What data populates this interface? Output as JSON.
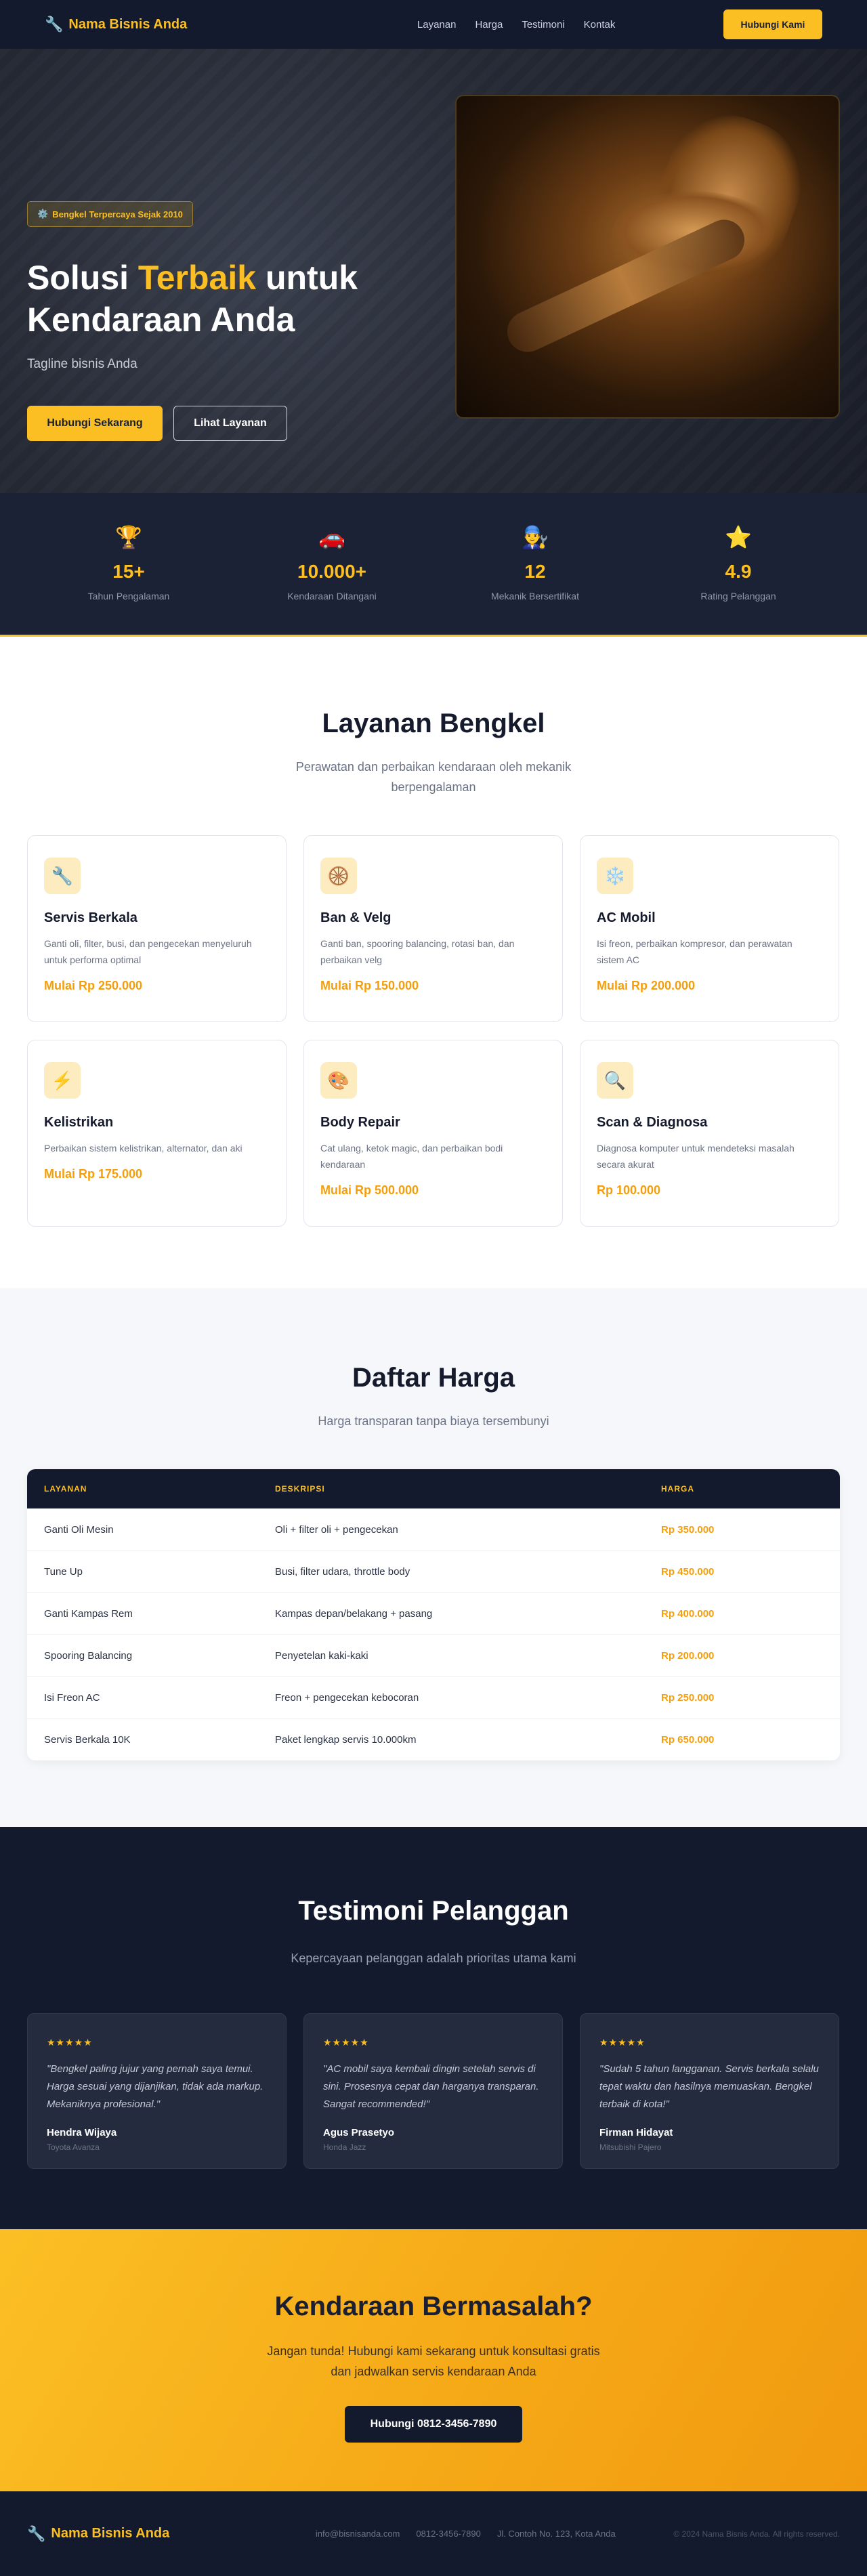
{
  "nav": {
    "brand": "Nama Bisnis Anda",
    "links": [
      "Layanan",
      "Harga",
      "Testimoni",
      "Kontak"
    ],
    "cta": "Hubungi Kami"
  },
  "hero": {
    "badge": "Bengkel Terpercaya Sejak 2010",
    "title_pre": "Solusi ",
    "title_highlight": "Terbaik",
    "title_post": " untuk Kendaraan Anda",
    "tagline": "Tagline bisnis Anda",
    "primary_btn": "Hubungi Sekarang",
    "secondary_btn": "Lihat Layanan"
  },
  "stats": [
    {
      "icon": "trophy-icon",
      "value": "15+",
      "label": "Tahun Pengalaman"
    },
    {
      "icon": "car-icon",
      "value": "10.000+",
      "label": "Kendaraan Ditangani"
    },
    {
      "icon": "mechanic-icon",
      "value": "12",
      "label": "Mekanik Bersertifikat"
    },
    {
      "icon": "star-icon",
      "value": "4.9",
      "label": "Rating Pelanggan"
    }
  ],
  "services": {
    "title": "Layanan Bengkel",
    "subtitle": "Perawatan dan perbaikan kendaraan oleh mekanik berpengalaman",
    "items": [
      {
        "icon": "wrench-icon",
        "name": "Servis Berkala",
        "desc": "Ganti oli, filter, busi, dan pengecekan menyeluruh untuk performa optimal",
        "price": "Mulai Rp 250.000"
      },
      {
        "icon": "wheel-icon",
        "name": "Ban & Velg",
        "desc": "Ganti ban, spooring balancing, rotasi ban, dan perbaikan velg",
        "price": "Mulai Rp 150.000"
      },
      {
        "icon": "snowflake-icon",
        "name": "AC Mobil",
        "desc": "Isi freon, perbaikan kompresor, dan perawatan sistem AC",
        "price": "Mulai Rp 200.000"
      },
      {
        "icon": "lightning-icon",
        "name": "Kelistrikan",
        "desc": "Perbaikan sistem kelistrikan, alternator, dan aki",
        "price": "Mulai Rp 175.000"
      },
      {
        "icon": "palette-icon",
        "name": "Body Repair",
        "desc": "Cat ulang, ketok magic, dan perbaikan bodi kendaraan",
        "price": "Mulai Rp 500.000"
      },
      {
        "icon": "magnifier-icon",
        "name": "Scan & Diagnosa",
        "desc": "Diagnosa komputer untuk mendeteksi masalah secara akurat",
        "price": "Rp 100.000"
      }
    ]
  },
  "prices": {
    "title": "Daftar Harga",
    "subtitle": "Harga transparan tanpa biaya tersembunyi",
    "headers": [
      "LAYANAN",
      "DESKRIPSI",
      "HARGA"
    ],
    "rows": [
      [
        "Ganti Oli Mesin",
        "Oli + filter oli + pengecekan",
        "Rp 350.000"
      ],
      [
        "Tune Up",
        "Busi, filter udara, throttle body",
        "Rp 450.000"
      ],
      [
        "Ganti Kampas Rem",
        "Kampas depan/belakang + pasang",
        "Rp 400.000"
      ],
      [
        "Spooring Balancing",
        "Penyetelan kaki-kaki",
        "Rp 200.000"
      ],
      [
        "Isi Freon AC",
        "Freon + pengecekan kebocoran",
        "Rp 250.000"
      ],
      [
        "Servis Berkala 10K",
        "Paket lengkap servis 10.000km",
        "Rp 650.000"
      ]
    ]
  },
  "testimonials": {
    "title": "Testimoni Pelanggan",
    "subtitle": "Kepercayaan pelanggan adalah prioritas utama kami",
    "stars": "★★★★★",
    "items": [
      {
        "quote": "\"Bengkel paling jujur yang pernah saya temui. Harga sesuai yang dijanjikan, tidak ada markup. Mekaniknya profesional.\"",
        "name": "Hendra Wijaya",
        "car": "Toyota Avanza"
      },
      {
        "quote": "\"AC mobil saya kembali dingin setelah servis di sini. Prosesnya cepat dan harganya transparan. Sangat recommended!\"",
        "name": "Agus Prasetyo",
        "car": "Honda Jazz"
      },
      {
        "quote": "\"Sudah 5 tahun langganan. Servis berkala selalu tepat waktu dan hasilnya memuaskan. Bengkel terbaik di kota!\"",
        "name": "Firman Hidayat",
        "car": "Mitsubishi Pajero"
      }
    ]
  },
  "cta": {
    "title": "Kendaraan Bermasalah?",
    "text": "Jangan tunda! Hubungi kami sekarang untuk konsultasi gratis dan jadwalkan servis kendaraan Anda",
    "button": "Hubungi 0812-3456-7890"
  },
  "footer": {
    "brand": "Nama Bisnis Anda",
    "email": "info@bisnisanda.com",
    "phone": "0812-3456-7890",
    "address": "Jl. Contoh No. 123, Kota Anda",
    "copyright": "© 2024 Nama Bisnis Anda. All rights reserved."
  },
  "colors": {
    "accent": "#fbbf24",
    "dark": "#141a2d",
    "price": "#f59e0b"
  }
}
